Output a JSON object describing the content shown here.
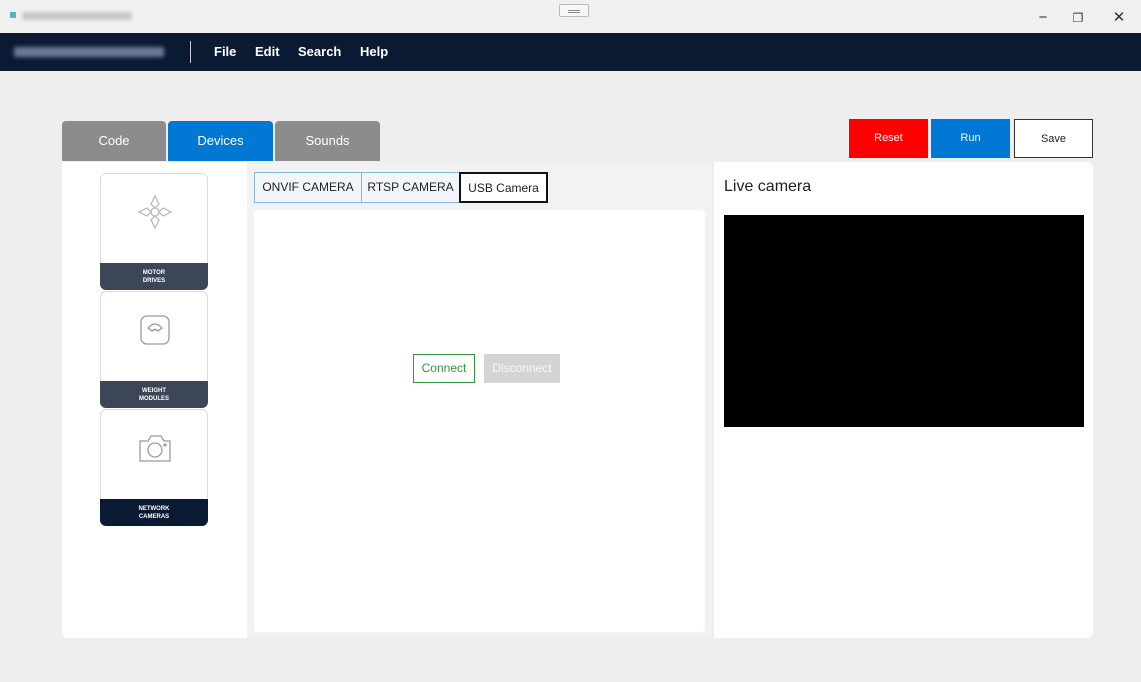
{
  "window": {
    "minimize_glyph": "−",
    "maximize_glyph": "❐",
    "close_glyph": "✕"
  },
  "menu": {
    "items": [
      "File",
      "Edit",
      "Search",
      "Help"
    ]
  },
  "tabs": [
    {
      "label": "Code",
      "active": false
    },
    {
      "label": "Devices",
      "active": true
    },
    {
      "label": "Sounds",
      "active": false
    }
  ],
  "actions": {
    "reset": "Reset",
    "run": "Run",
    "save": "Save"
  },
  "devices": [
    {
      "label": "MOTOR\nDRIVES",
      "icon": "motor-drive-icon"
    },
    {
      "label": "WEIGHT\nMODULES",
      "icon": "weight-scale-icon"
    },
    {
      "label": "NETWORK\nCAMERAS",
      "icon": "camera-icon",
      "selected": true
    }
  ],
  "camera_tabs": [
    {
      "label": "ONVIF CAMERA"
    },
    {
      "label": "RTSP CAMERA"
    },
    {
      "label": "USB Camera",
      "active": true
    }
  ],
  "camera_controls": {
    "connect": "Connect",
    "disconnect": "Disconnect"
  },
  "live": {
    "title": "Live camera"
  },
  "colors": {
    "menubar": "#0b1a33",
    "tab_active": "#0078d4",
    "tab_inactive": "#8c8c8c",
    "reset": "#ff0000",
    "run": "#0078d4",
    "connect": "#2e9a3a"
  }
}
